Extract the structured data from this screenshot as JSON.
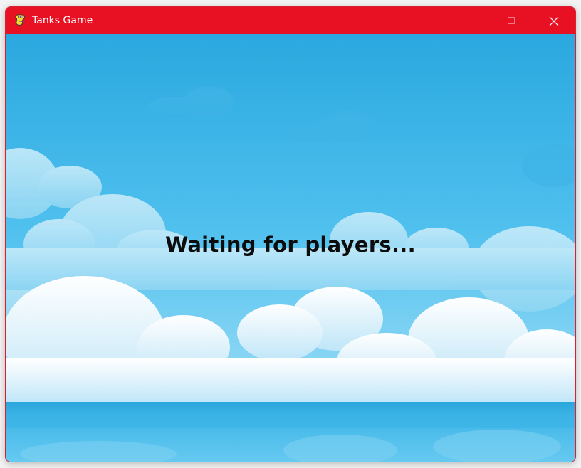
{
  "window": {
    "title": "Tanks Game",
    "app_icon": "pygame-snake-icon",
    "titlebar_color": "#e81123"
  },
  "controls": {
    "minimize_icon": "minimize-icon",
    "maximize_icon": "maximize-icon",
    "close_icon": "close-icon"
  },
  "game": {
    "status_text": "Waiting for players...",
    "background": "sky-with-clouds",
    "sky_color": "#2aa9e0"
  }
}
